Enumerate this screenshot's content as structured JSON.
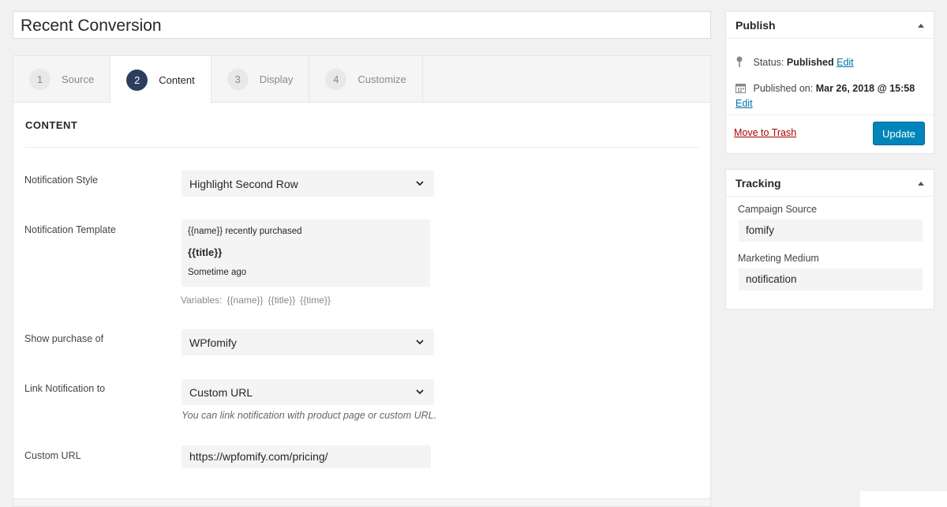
{
  "title": "Recent Conversion",
  "steps": [
    {
      "num": "1",
      "label": "Source"
    },
    {
      "num": "2",
      "label": "Content"
    },
    {
      "num": "3",
      "label": "Display"
    },
    {
      "num": "4",
      "label": "Customize"
    }
  ],
  "content": {
    "section_title": "CONTENT",
    "notification_style": {
      "label": "Notification Style",
      "value": "Highlight Second Row"
    },
    "notification_template": {
      "label": "Notification Template",
      "line1": "{{name}} recently purchased",
      "line2": "{{title}}",
      "line3": "Sometime ago"
    },
    "variables": {
      "prefix": "Variables:",
      "items": [
        "{{name}}",
        "{{title}}",
        "{{time}}"
      ]
    },
    "show_purchase": {
      "label": "Show purchase of",
      "value": "WPfomify"
    },
    "link_notification": {
      "label": "Link Notification to",
      "value": "Custom URL",
      "hint": "You can link notification with product page or custom URL."
    },
    "custom_url": {
      "label": "Custom URL",
      "value": "https://wpfomify.com/pricing/"
    }
  },
  "publish": {
    "heading": "Publish",
    "status_label": "Status:",
    "status_value": "Published",
    "edit_label": "Edit",
    "published_label": "Published on:",
    "published_value": "Mar 26, 2018 @ 15:58",
    "trash_label": "Move to Trash",
    "update_label": "Update"
  },
  "tracking": {
    "heading": "Tracking",
    "campaign_source_label": "Campaign Source",
    "campaign_source_value": "fomify",
    "marketing_medium_label": "Marketing Medium",
    "marketing_medium_value": "notification"
  },
  "colors": {
    "accent": "#2c3e5c",
    "button": "#0085ba",
    "link": "#0073aa",
    "danger": "#a00"
  }
}
